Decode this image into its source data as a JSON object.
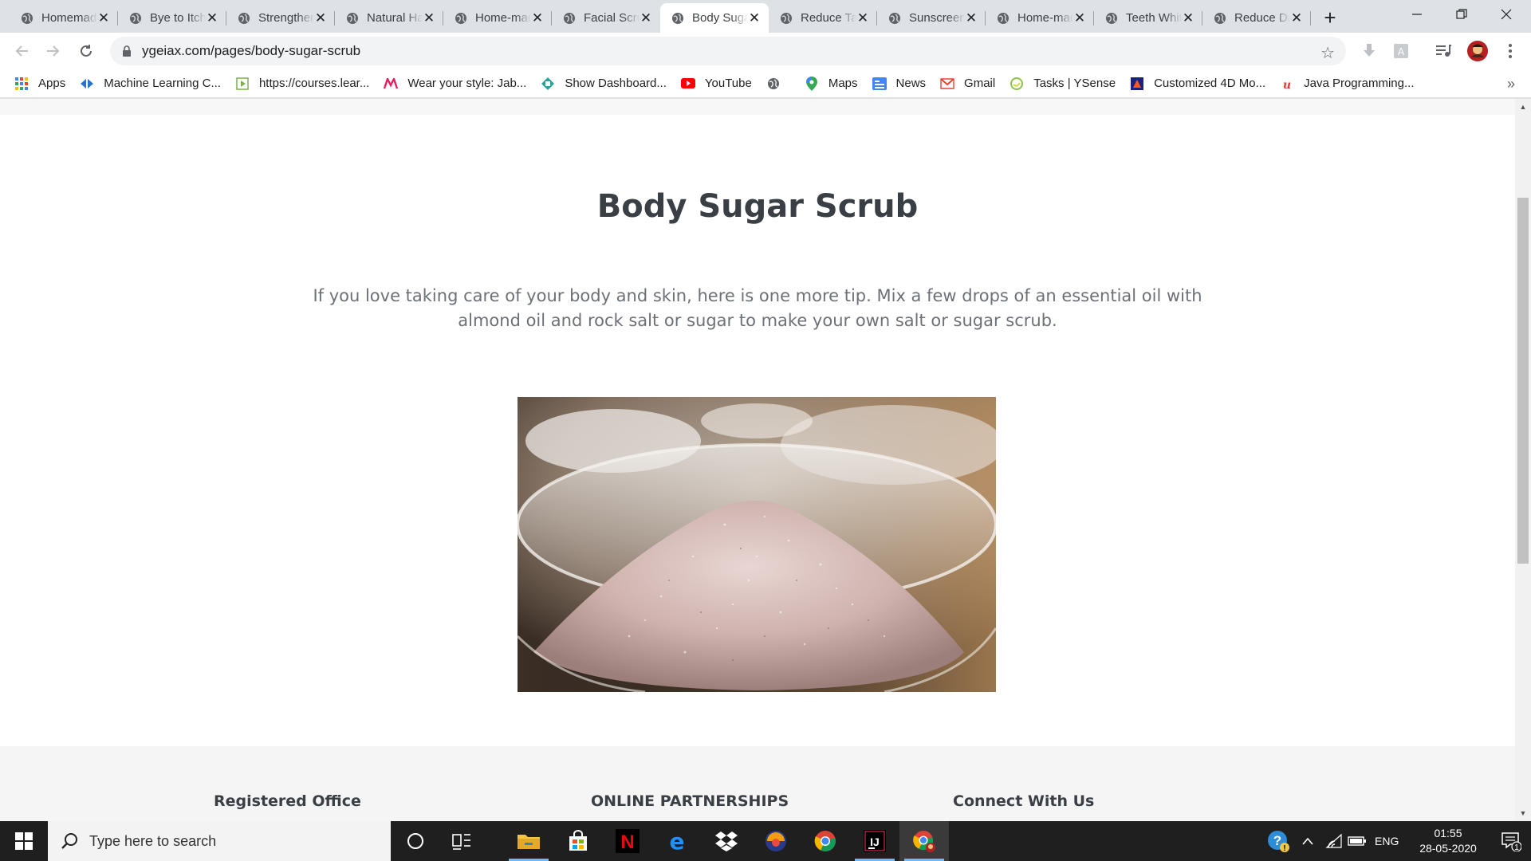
{
  "browser": {
    "tabs": [
      {
        "title": "Homemade",
        "active": false
      },
      {
        "title": "Bye to Itchy",
        "active": false
      },
      {
        "title": "Strengthen",
        "active": false
      },
      {
        "title": "Natural Hair",
        "active": false
      },
      {
        "title": "Home-made",
        "active": false
      },
      {
        "title": "Facial Scrub",
        "active": false
      },
      {
        "title": "Body Sugar",
        "active": true
      },
      {
        "title": "Reduce Tan",
        "active": false
      },
      {
        "title": "Sunscreen",
        "active": false
      },
      {
        "title": "Home-made",
        "active": false
      },
      {
        "title": "Teeth Whitening",
        "active": false
      },
      {
        "title": "Reduce Dark",
        "active": false
      }
    ],
    "url": "ygeiax.com/pages/body-sugar-scrub",
    "bookmarks": [
      {
        "label": "Apps",
        "icon": "apps-grid-icon"
      },
      {
        "label": "Machine Learning C...",
        "icon": "coursera-icon"
      },
      {
        "label": "https://courses.lear...",
        "icon": "courses-icon"
      },
      {
        "label": "Wear your style: Jab...",
        "icon": "myntra-icon"
      },
      {
        "label": "Show Dashboard...",
        "icon": "dashboard-icon"
      },
      {
        "label": "YouTube",
        "icon": "youtube-icon"
      },
      {
        "label": "",
        "icon": "globe-icon"
      },
      {
        "label": "Maps",
        "icon": "maps-icon"
      },
      {
        "label": "News",
        "icon": "news-icon"
      },
      {
        "label": "Gmail",
        "icon": "gmail-icon"
      },
      {
        "label": "Tasks | YSense",
        "icon": "ysense-icon"
      },
      {
        "label": "Customized 4D Mo...",
        "icon": "customized-icon"
      },
      {
        "label": "Java Programming...",
        "icon": "java-icon"
      }
    ],
    "bookmarks_more": "»"
  },
  "page": {
    "title": "Body Sugar Scrub",
    "description": "If you love taking care of your body and skin, here is one more tip. Mix a few drops of an essential oil with almond oil and rock salt or sugar to make your own salt or sugar scrub.",
    "footer": {
      "col1": "Registered Office",
      "col2": "ONLINE PARTNERSHIPS",
      "col3": "Connect With Us"
    }
  },
  "taskbar": {
    "search_placeholder": "Type here to search",
    "language": "ENG",
    "time": "01:55",
    "date": "28-05-2020",
    "notification_count": "1"
  },
  "colors": {
    "title_text": "#3a3f45",
    "body_text": "#6c7177",
    "taskbar_bg": "#1f1f1f",
    "tabstrip_bg": "#dee1e6"
  }
}
